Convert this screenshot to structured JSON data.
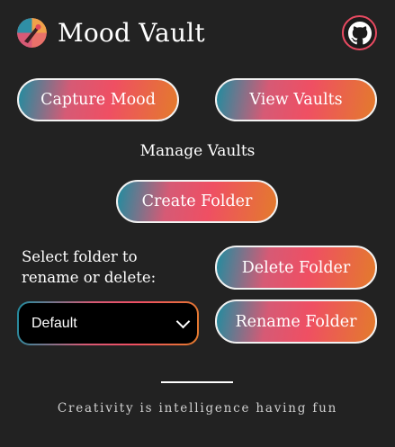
{
  "header": {
    "title": "Mood Vault",
    "logo_icon": "palette-logo-icon",
    "github_icon": "github-icon"
  },
  "actions": {
    "capture_label": "Capture Mood",
    "view_label": "View Vaults"
  },
  "manage": {
    "heading": "Manage Vaults",
    "create_label": "Create Folder",
    "select_label": "Select folder to rename or delete:",
    "selected_folder": "Default",
    "delete_label": "Delete Folder",
    "rename_label": "Rename Folder"
  },
  "footer": {
    "quote": "Creativity is intelligence having fun"
  },
  "colors": {
    "background": "#222222",
    "gradient_teal": "#1f8da0",
    "gradient_pink": "#ef4f63",
    "gradient_orange": "#e37b2c",
    "accent_border": "#e84a61"
  }
}
